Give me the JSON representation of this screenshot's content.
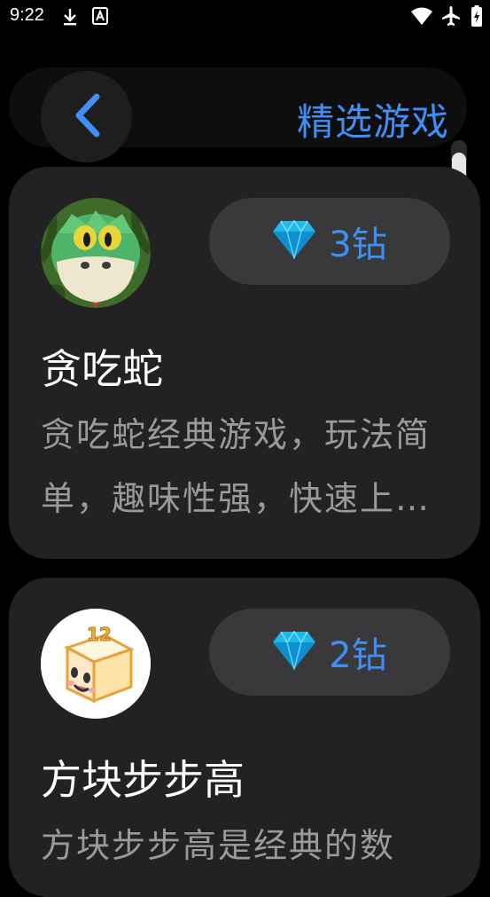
{
  "status_bar": {
    "time": "9:22",
    "icons": [
      "download-icon",
      "a-badge-icon",
      "wifi-icon",
      "airplane-icon",
      "battery-icon"
    ]
  },
  "header": {
    "back_icon": "chevron-left-icon",
    "title": "精选游戏"
  },
  "colors": {
    "accent": "#3f8ff5",
    "card": "#222224",
    "pill": "#39393b",
    "desc": "#9a9a9a"
  },
  "games": [
    {
      "name": "贪吃蛇",
      "price": "3钻",
      "description": "贪吃蛇经典游戏，玩法简单，趣味性强，快速上手体验",
      "icon": "snake-game-icon"
    },
    {
      "name": "方块步步高",
      "price": "2钻",
      "description": "方块步步高是经典的数",
      "icon": "block-game-icon"
    }
  ]
}
